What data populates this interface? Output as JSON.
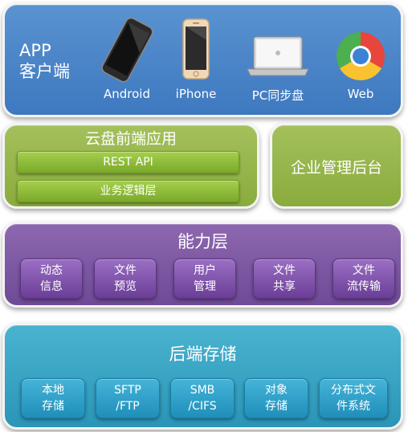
{
  "client_layer": {
    "title_line1": "APP",
    "title_line2": "客户端",
    "devices": [
      {
        "label": "Android",
        "icon": "android-phone-icon"
      },
      {
        "label": "iPhone",
        "icon": "iphone-icon"
      },
      {
        "label": "PC同步盘",
        "icon": "laptop-icon"
      },
      {
        "label": "Web",
        "icon": "chrome-browser-icon"
      }
    ]
  },
  "frontend_layer": {
    "title": "云盘前端应用",
    "bars": [
      "REST API",
      "业务逻辑层"
    ]
  },
  "admin_layer": {
    "title": "企业管理后台"
  },
  "capability_layer": {
    "title": "能力层",
    "tiles": [
      "动态\n信息",
      "文件\n预览",
      "用户\n管理",
      "文件\n共享",
      "文件\n流传输"
    ]
  },
  "storage_layer": {
    "title": "后端存储",
    "tiles": [
      "本地\n存储",
      "SFTP\n/FTP",
      "SMB\n/CIFS",
      "对象\n存储",
      "分布式文\n件系统"
    ]
  },
  "colors": {
    "client": "#4a86c8",
    "frontend": "#97b548",
    "capability": "#7e5aa3",
    "storage": "#39a6c6"
  }
}
